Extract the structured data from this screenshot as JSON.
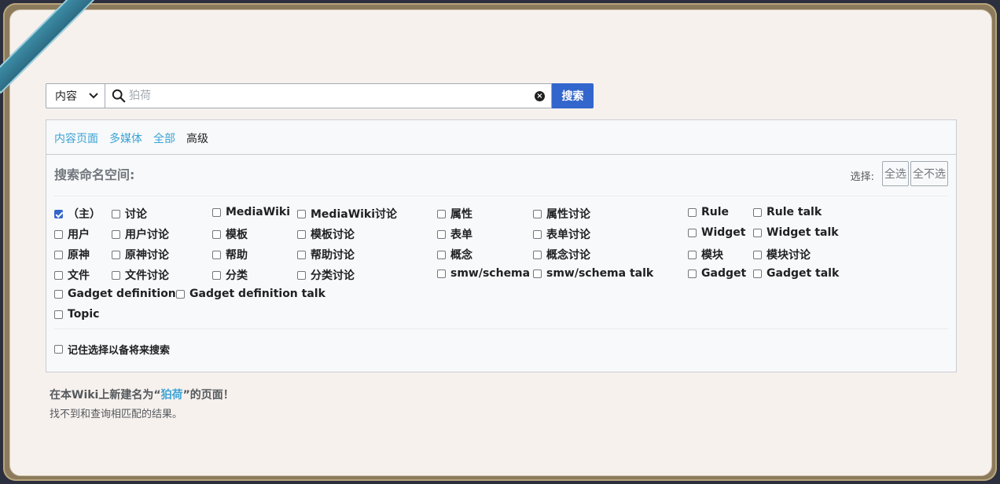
{
  "search": {
    "namespace_select": "内容",
    "placeholder": "狛荷",
    "button": "搜索"
  },
  "tabs": [
    "内容页面",
    "多媒体",
    "全部",
    "高级"
  ],
  "active_tab": 3,
  "namespaces": {
    "title": "搜索命名空间:",
    "select_label": "选择:",
    "select_all": "全选",
    "select_none": "全不选",
    "items": [
      {
        "label": "（主）",
        "checked": true
      },
      {
        "label": "讨论",
        "checked": false
      },
      {
        "label": "MediaWiki",
        "checked": false
      },
      {
        "label": "MediaWiki讨论",
        "checked": false
      },
      {
        "label": "属性",
        "checked": false
      },
      {
        "label": "属性讨论",
        "checked": false
      },
      {
        "label": "Rule",
        "checked": false
      },
      {
        "label": "Rule talk",
        "checked": false
      },
      {
        "label": "用户",
        "checked": false
      },
      {
        "label": "用户讨论",
        "checked": false
      },
      {
        "label": "模板",
        "checked": false
      },
      {
        "label": "模板讨论",
        "checked": false
      },
      {
        "label": "表单",
        "checked": false
      },
      {
        "label": "表单讨论",
        "checked": false
      },
      {
        "label": "Widget",
        "checked": false
      },
      {
        "label": "Widget talk",
        "checked": false
      },
      {
        "label": "原神",
        "checked": false
      },
      {
        "label": "原神讨论",
        "checked": false
      },
      {
        "label": "帮助",
        "checked": false
      },
      {
        "label": "帮助讨论",
        "checked": false
      },
      {
        "label": "概念",
        "checked": false
      },
      {
        "label": "概念讨论",
        "checked": false
      },
      {
        "label": "模块",
        "checked": false
      },
      {
        "label": "模块讨论",
        "checked": false
      },
      {
        "label": "文件",
        "checked": false
      },
      {
        "label": "文件讨论",
        "checked": false
      },
      {
        "label": "分类",
        "checked": false
      },
      {
        "label": "分类讨论",
        "checked": false
      },
      {
        "label": "smw/schema",
        "checked": false
      },
      {
        "label": "smw/schema talk",
        "checked": false
      },
      {
        "label": "Gadget",
        "checked": false
      },
      {
        "label": "Gadget talk",
        "checked": false
      },
      {
        "label": "Gadget definition",
        "checked": false
      },
      {
        "label": "Gadget definition talk",
        "checked": false
      },
      {
        "label": "Topic",
        "checked": false
      }
    ],
    "remember": "记住选择以备将来搜索"
  },
  "create": {
    "prefix": "在本Wiki上新建名为“",
    "link": "狛荷",
    "suffix": "”的页面！"
  },
  "no_result": "找不到和查询相匹配的结果。"
}
